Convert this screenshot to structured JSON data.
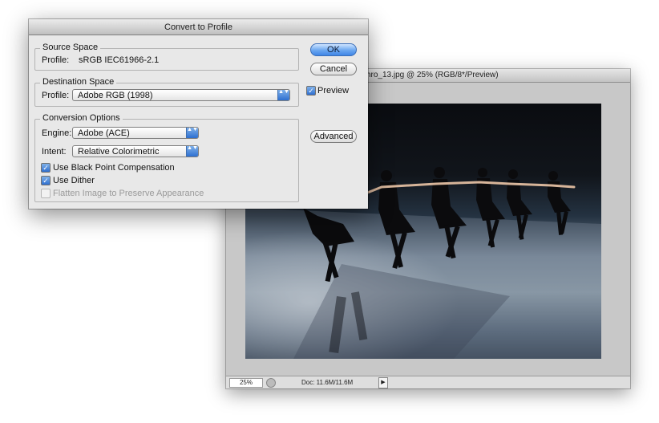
{
  "dialog": {
    "title": "Convert to Profile",
    "source_space": {
      "label": "Source Space",
      "profile_label": "Profile:",
      "profile_value": "sRGB IEC61966-2.1"
    },
    "destination_space": {
      "label": "Destination Space",
      "profile_label": "Profile:",
      "profile_value": "Adobe RGB (1998)"
    },
    "conversion_options": {
      "label": "Conversion Options",
      "engine_label": "Engine:",
      "engine_value": "Adobe (ACE)",
      "intent_label": "Intent:",
      "intent_value": "Relative Colorimetric",
      "black_point_label": "Use Black Point Compensation",
      "black_point_checked": true,
      "dither_label": "Use Dither",
      "dither_checked": true,
      "flatten_label": "Flatten Image to Preserve Appearance",
      "flatten_checked": false,
      "flatten_enabled": false
    },
    "buttons": {
      "ok": "OK",
      "cancel": "Cancel",
      "advanced": "Advanced"
    },
    "preview_label": "Preview",
    "preview_checked": true
  },
  "document": {
    "title": "nchro_13.jpg @ 25% (RGB/8*/Preview)",
    "zoom": "25%",
    "doc_size": "Doc: 11.6M/11.6M"
  },
  "icons": {
    "check": "✓",
    "popup_arrows": "▲▼",
    "status_arrow": "▶"
  },
  "colors": {
    "accent": "#3f86e6",
    "dialog_bg": "#e8e8e8"
  }
}
